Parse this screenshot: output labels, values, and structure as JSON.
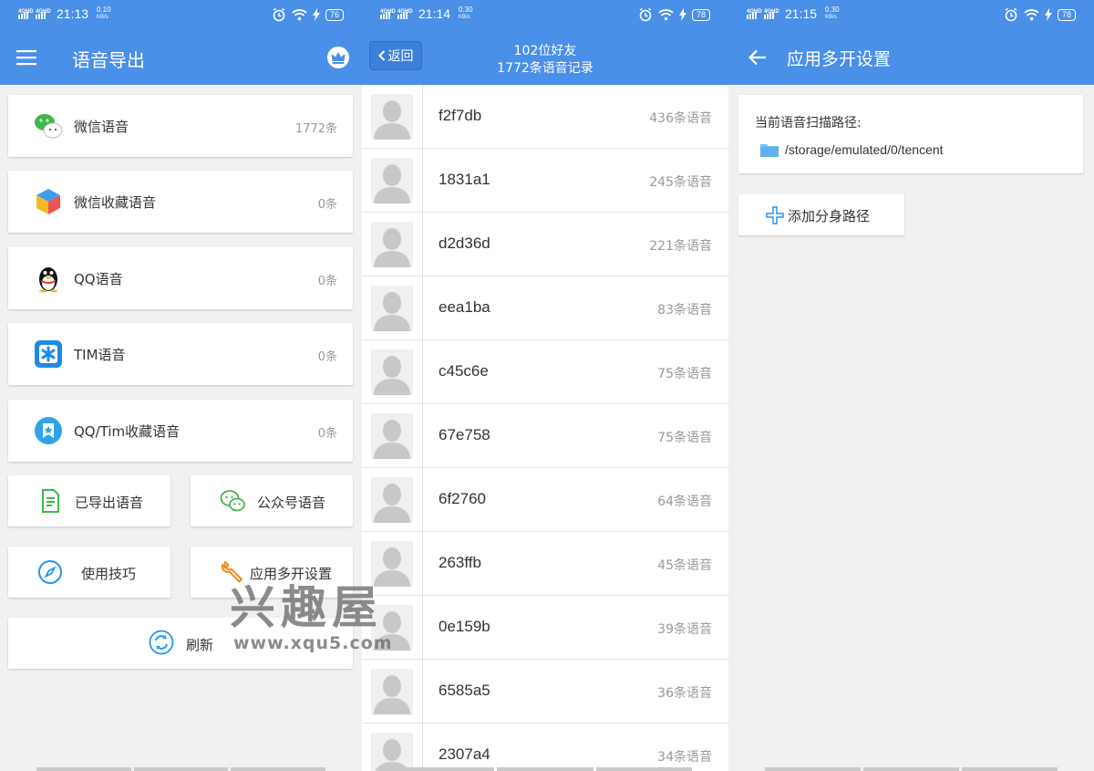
{
  "colors": {
    "appbar": "#4a8fe8",
    "count_gray": "#999999"
  },
  "panel1": {
    "status": {
      "network": "4GHD",
      "time": "21:13",
      "speed": "0.10",
      "speed_unit": "KB/s",
      "battery": "76"
    },
    "title": "语音导出",
    "menu_icon": "hamburger-icon",
    "vip_icon": "crown-icon",
    "cards": [
      {
        "label": "微信语音",
        "count": "1772条",
        "icon": "wechat-icon"
      },
      {
        "label": "微信收藏语音",
        "count": "0条",
        "icon": "cube-icon"
      },
      {
        "label": "QQ语音",
        "count": "0条",
        "icon": "qq-penguin-icon"
      },
      {
        "label": "TIM语音",
        "count": "0条",
        "icon": "tim-icon"
      },
      {
        "label": "QQ/Tim收藏语音",
        "count": "0条",
        "icon": "star-badge-icon"
      }
    ],
    "buttons": {
      "exported": "已导出语音",
      "official": "公众号语音",
      "tips": "使用技巧",
      "multi": "应用多开设置",
      "refresh": "刷新"
    }
  },
  "panel2": {
    "status": {
      "network": "4GHD",
      "time": "21:14",
      "speed": "0.30",
      "speed_unit": "KB/s",
      "battery": "78"
    },
    "back": "返回",
    "header_line1": "102位好友",
    "header_line2": "1772条语音记录",
    "friends": [
      {
        "name": "f2f7db",
        "count": "436条语音"
      },
      {
        "name": "1831a1",
        "count": "245条语音"
      },
      {
        "name": "d2d36d",
        "count": "221条语音"
      },
      {
        "name": "eea1ba",
        "count": "83条语音"
      },
      {
        "name": "c45c6e",
        "count": "75条语音"
      },
      {
        "name": "67e758",
        "count": "75条语音"
      },
      {
        "name": "6f2760",
        "count": "64条语音"
      },
      {
        "name": "263ffb",
        "count": "45条语音"
      },
      {
        "name": "0e159b",
        "count": "39条语音"
      },
      {
        "name": "6585a5",
        "count": "36条语音"
      },
      {
        "name": "2307a4",
        "count": "34条语音"
      }
    ]
  },
  "panel3": {
    "status": {
      "network": "4GHD",
      "time": "21:15",
      "speed": "0.30",
      "speed_unit": "KB/s",
      "battery": "78"
    },
    "title": "应用多开设置",
    "path_label": "当前语音扫描路径:",
    "path_value": "/storage/emulated/0/tencent",
    "add_button": "添加分身路径"
  },
  "watermark": {
    "big": "兴趣屋",
    "small": "www.xqu5.com"
  }
}
